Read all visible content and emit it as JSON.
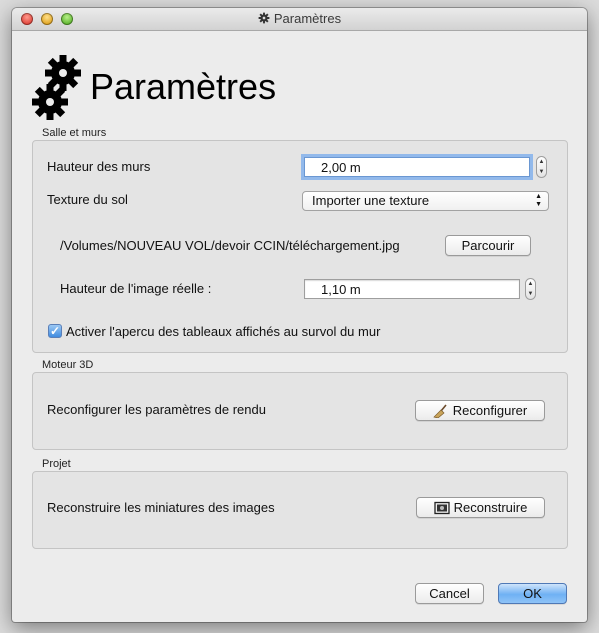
{
  "window": {
    "title": "Paramètres"
  },
  "header": {
    "title": "Paramètres"
  },
  "salle": {
    "group_label": "Salle et murs",
    "wall_height_label": "Hauteur des murs",
    "wall_height_value": "2,00 m",
    "texture_label": "Texture du sol",
    "texture_selected": "Importer une texture",
    "texture_path": "/Volumes/NOUVEAU VOL/devoir CCIN/téléchargement.jpg",
    "browse_label": "Parcourir",
    "image_height_label": "Hauteur de l'image réelle :",
    "image_height_value": "1,10 m",
    "preview_checkbox_label": "Activer l'apercu des tableaux affichés au survol du mur",
    "preview_checked": true
  },
  "moteur": {
    "group_label": "Moteur 3D",
    "text": "Reconfigurer les paramètres de rendu",
    "button_label": "Reconfigurer"
  },
  "projet": {
    "group_label": "Projet",
    "text": "Reconstruire les miniatures des images",
    "button_label": "Reconstruire"
  },
  "footer": {
    "cancel_label": "Cancel",
    "ok_label": "OK"
  },
  "colors": {
    "accent": "#6fb1f4",
    "focus_ring": "#92b9eb"
  }
}
